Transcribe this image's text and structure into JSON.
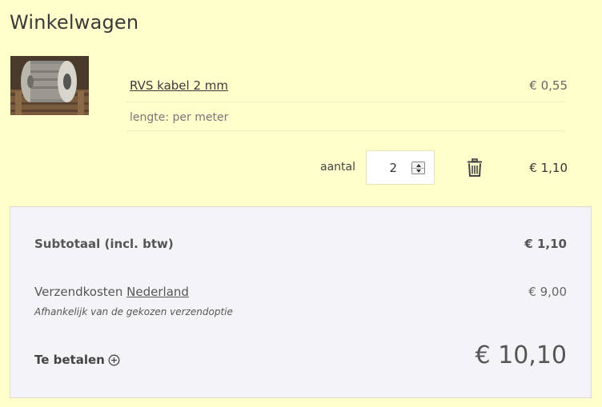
{
  "page": {
    "title": "Winkelwagen"
  },
  "cart_item": {
    "name": "RVS kabel 2 mm",
    "unit_price": "€ 0,55",
    "option": "lengte: per meter",
    "quantity_label": "aantal",
    "quantity": "2",
    "line_total": "€ 1,10",
    "image_icon": "cable-reel-photo",
    "delete_icon": "trash-icon"
  },
  "summary": {
    "subtotal_label": "Subtotaal (incl. btw)",
    "subtotal_value": "€ 1,10",
    "shipping_label": "Verzendkosten",
    "shipping_country": "Nederland",
    "shipping_value": "€ 9,00",
    "shipping_note": "Afhankelijk van de gekozen verzendoptie",
    "total_label": "Te betalen",
    "total_value": "€ 10,10",
    "expand_icon": "plus-circle-icon"
  },
  "colors": {
    "background": "#ffffcc",
    "summary_background": "#f4f4f8"
  }
}
